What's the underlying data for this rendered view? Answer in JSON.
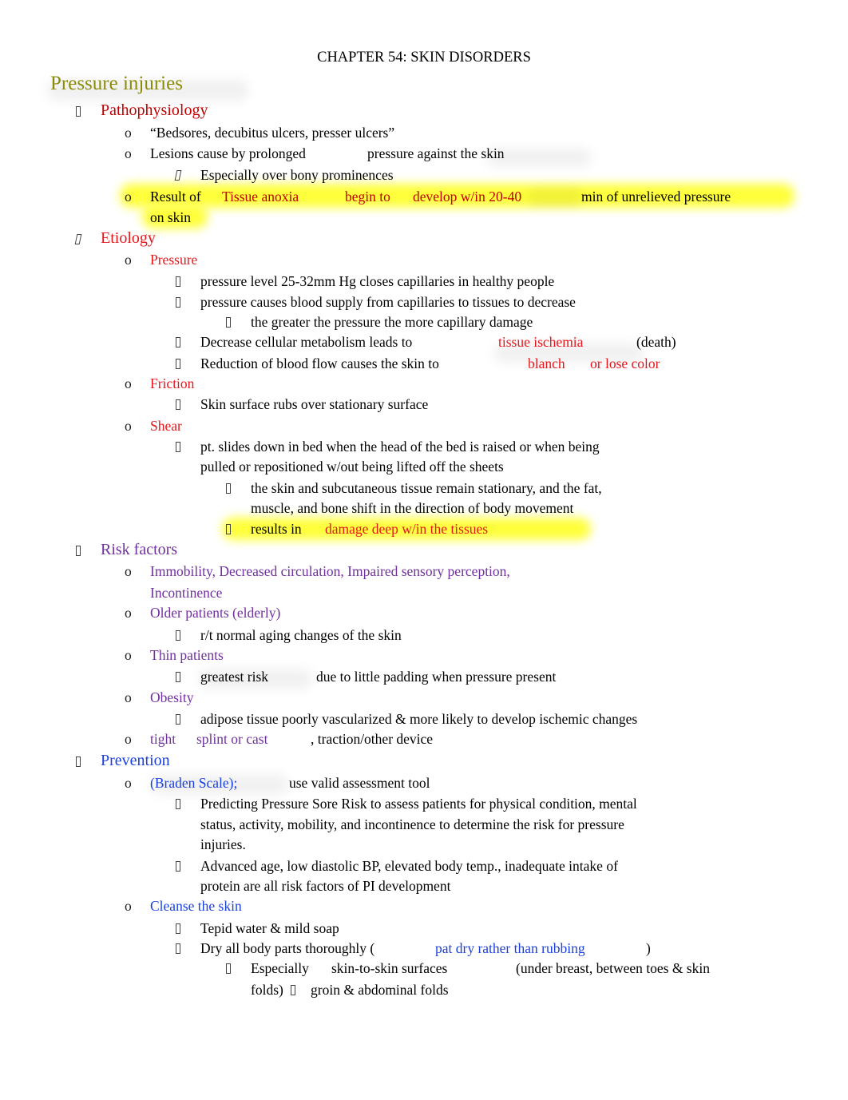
{
  "document": {
    "title": "CHAPTER 54: SKIN DISORDERS",
    "section_title": "Pressure injuries",
    "colors": {
      "section_title": "#8c8c0a",
      "red_heading": "#e8151b",
      "dark_red": "#c00000",
      "purple": "#7030a0",
      "blue": "#1a3fe0",
      "highlight": "#ffff3a"
    },
    "pathophysiology": {
      "heading": "Pathophysiology",
      "item1": "“Bedsores, decubitus ulcers, presser ulcers”",
      "item2_a": "Lesions cause by prolonged",
      "item2_b": "pressure against the skin",
      "item2_sub": "Especially over bony prominences",
      "item3_a": "Result of",
      "item3_b": "Tissue anoxia",
      "item3_c": "begin to",
      "item3_d": "develop w/in 20-40",
      "item3_e": "min of unrelieved pressure",
      "item3_f": "on skin"
    },
    "etiology": {
      "heading": "Etiology",
      "pressure": {
        "label": "Pressure",
        "p1": "pressure level 25-32mm Hg closes capillaries in healthy people",
        "p2": "pressure causes blood supply from capillaries to tissues to decrease",
        "p2_sub": "the greater the pressure the more capillary damage",
        "p3_a": "Decrease cellular metabolism leads to",
        "p3_b": "tissue ischemia",
        "p3_c": "(death)",
        "p4_a": "Reduction of blood flow causes the skin to",
        "p4_b": "blanch",
        "p4_c": "or lose color"
      },
      "friction": {
        "label": "Friction",
        "f1": "Skin surface rubs over stationary surface"
      },
      "shear": {
        "label": "Shear",
        "s1_line1": "pt. slides down in bed when the head of the bed is raised or when being",
        "s1_line2": "pulled or repositioned w/out being lifted off the sheets",
        "s1_sub1_line1": "the skin and subcutaneous tissue remain stationary, and the fat,",
        "s1_sub1_line2": "muscle, and bone shift in the direction of body movement",
        "s1_sub2_a": "results in",
        "s1_sub2_b": "damage deep w/in the tissues"
      }
    },
    "risk_factors": {
      "heading": "Risk factors",
      "r1_line1": "Immobility, Decreased circulation, Impaired sensory perception,",
      "r1_line2": "Incontinence",
      "r2": "Older patients (elderly)",
      "r2_sub": "r/t normal aging changes of the skin",
      "r3": "Thin patients",
      "r3_sub_a": "greatest risk",
      "r3_sub_b": "due to little padding when pressure present",
      "r4": "Obesity",
      "r4_sub": "adipose tissue poorly vascularized & more likely to develop ischemic changes",
      "r5_a": "tight",
      "r5_b": "splint or cast",
      "r5_c": ", traction/other device"
    },
    "prevention": {
      "heading": "Prevention",
      "braden_a": "(Braden Scale);",
      "braden_b": "use valid assessment tool",
      "braden_sub1_line1": "Predicting Pressure Sore Risk to assess patients for physical condition, mental",
      "braden_sub1_line2": "status, activity, mobility, and incontinence to determine the risk for pressure",
      "braden_sub1_line3": "injuries.",
      "braden_sub2_line1": "Advanced age, low diastolic BP, elevated body temp., inadequate intake of",
      "braden_sub2_line2": "protein are all risk factors of PI development",
      "cleanse": "Cleanse the skin",
      "cleanse_sub1": "Tepid water & mild soap",
      "cleanse_sub2_a": "Dry all body parts thoroughly (",
      "cleanse_sub2_b": "pat dry rather than rubbing",
      "cleanse_sub2_c": ")",
      "cleanse_sub3_a": "Especially",
      "cleanse_sub3_b": "skin-to-skin surfaces",
      "cleanse_sub3_c": "(under breast, between toes & skin",
      "cleanse_sub3_d": "folds)",
      "cleanse_sub3_e": "groin & abdominal folds"
    },
    "bullets": {
      "level2": "o"
    }
  }
}
